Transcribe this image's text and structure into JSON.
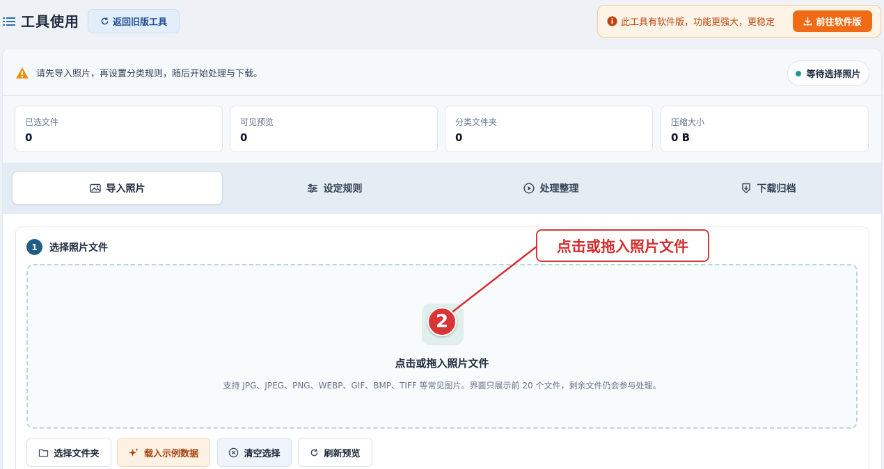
{
  "header": {
    "title": "工具使用",
    "old_tool_label": "返回旧版工具",
    "notice_text": "此工具有软件版，功能更强大，更稳定",
    "notice_button": "前往软件版"
  },
  "status": {
    "tip": "请先导入照片，再设置分类规则，随后开始处理与下载。",
    "state": "等待选择照片"
  },
  "stats": [
    {
      "label": "已选文件",
      "value": "0"
    },
    {
      "label": "可见预览",
      "value": "0"
    },
    {
      "label": "分类文件夹",
      "value": "0"
    },
    {
      "label": "压缩大小",
      "value": "0 B"
    }
  ],
  "tabs": [
    {
      "label": "导入照片",
      "icon": "image-icon",
      "active": true
    },
    {
      "label": "设定规则",
      "icon": "sliders-icon",
      "active": false
    },
    {
      "label": "处理整理",
      "icon": "play-circle-icon",
      "active": false
    },
    {
      "label": "下载归档",
      "icon": "download-box-icon",
      "active": false
    }
  ],
  "step": {
    "number": "1",
    "title": "选择照片文件"
  },
  "dropzone": {
    "title": "点击或拖入照片文件",
    "hint": "支持 JPG、JPEG、PNG、WEBP、GIF、BMP、TIFF 等常见图片。界面只展示前 20 个文件，剩余文件仍会参与处理。"
  },
  "actions": [
    {
      "label": "选择文件夹",
      "icon": "folder-icon"
    },
    {
      "label": "载入示例数据",
      "icon": "sparkle-icon"
    },
    {
      "label": "清空选择",
      "icon": "clear-circle-icon"
    },
    {
      "label": "刷新预览",
      "icon": "refresh-icon"
    }
  ],
  "annotation": {
    "callout": "点击或拖入照片文件",
    "marker": "2",
    "color": "#d42d2d"
  },
  "colors": {
    "accent": "#1f5e86",
    "orange": "#f06b16",
    "teal": "#159b8a"
  }
}
